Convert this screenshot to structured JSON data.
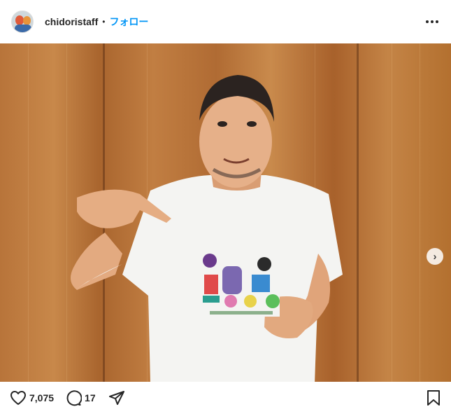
{
  "header": {
    "username": "chidoristaff",
    "separator": "•",
    "follow_label": "フォロー"
  },
  "post": {
    "carousel": {
      "slides": 2,
      "current": 1
    }
  },
  "actions": {
    "likes": "7,075",
    "comments": "17"
  },
  "colors": {
    "follow_blue": "#0095f6",
    "text": "#262626",
    "wood": "#b8743a"
  },
  "icons": [
    "avatar",
    "more-options-icon",
    "chevron-right-icon",
    "heart-icon",
    "comment-icon",
    "share-icon",
    "bookmark-icon"
  ]
}
